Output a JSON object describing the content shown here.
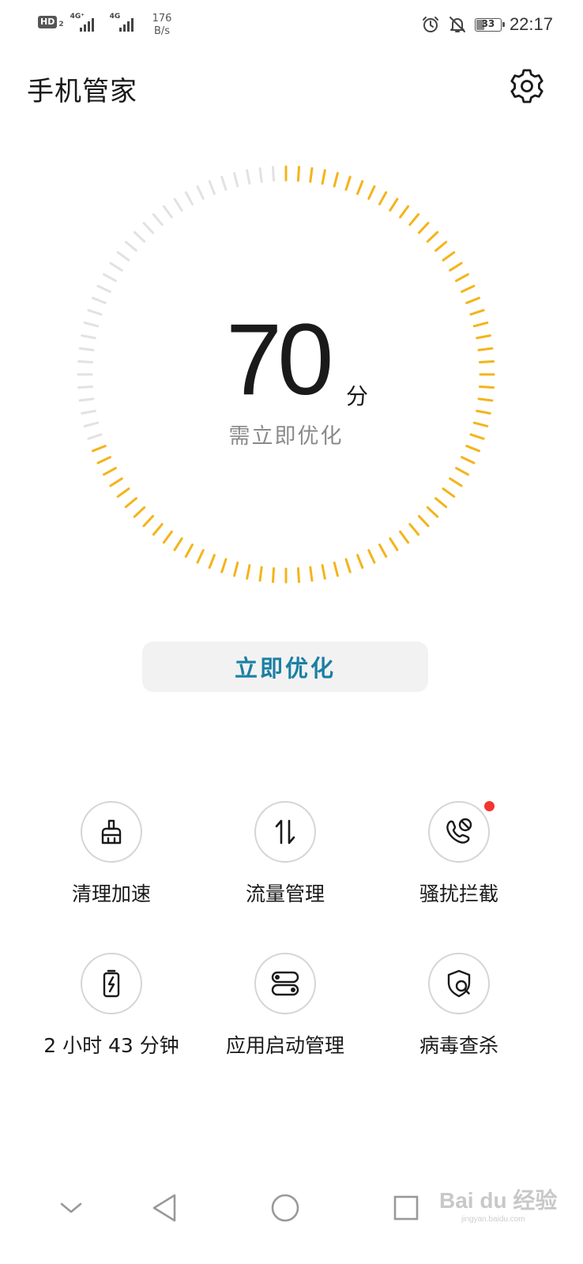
{
  "status_bar": {
    "hd_badge": "HD",
    "hd_sub": "2",
    "sim1_label": "4G⁺",
    "sim2_label": "4G",
    "net_speed_value": "176",
    "net_speed_unit": "B/s",
    "battery_level": "33",
    "time": "22:17",
    "icons": [
      "alarm-icon",
      "mute-bell-icon",
      "battery-icon"
    ]
  },
  "header": {
    "title": "手机管家",
    "settings_icon": "gear-icon"
  },
  "score": {
    "value": "70",
    "unit": "分",
    "status": "需立即优化",
    "fraction": 0.7,
    "colors": {
      "active": "#f4b41a",
      "inactive": "#e2e2e2"
    }
  },
  "optimize_button": {
    "label": "立即优化",
    "color": "#1b7fa3"
  },
  "features": [
    {
      "label": "清理加速",
      "icon": "broom-icon"
    },
    {
      "label": "流量管理",
      "icon": "data-arrows-icon"
    },
    {
      "label": "骚扰拦截",
      "icon": "call-block-icon",
      "badge": true
    },
    {
      "label": "2 小时 43 分钟",
      "icon": "battery-charging-icon"
    },
    {
      "label": "应用启动管理",
      "icon": "app-launch-icon"
    },
    {
      "label": "病毒查杀",
      "icon": "shield-search-icon"
    }
  ],
  "nav_bar": {
    "buttons": [
      "collapse-icon",
      "back-icon",
      "home-icon",
      "recents-icon"
    ]
  },
  "watermark": {
    "text": "Bai du 经验",
    "sub": "jingyan.baidu.com"
  }
}
